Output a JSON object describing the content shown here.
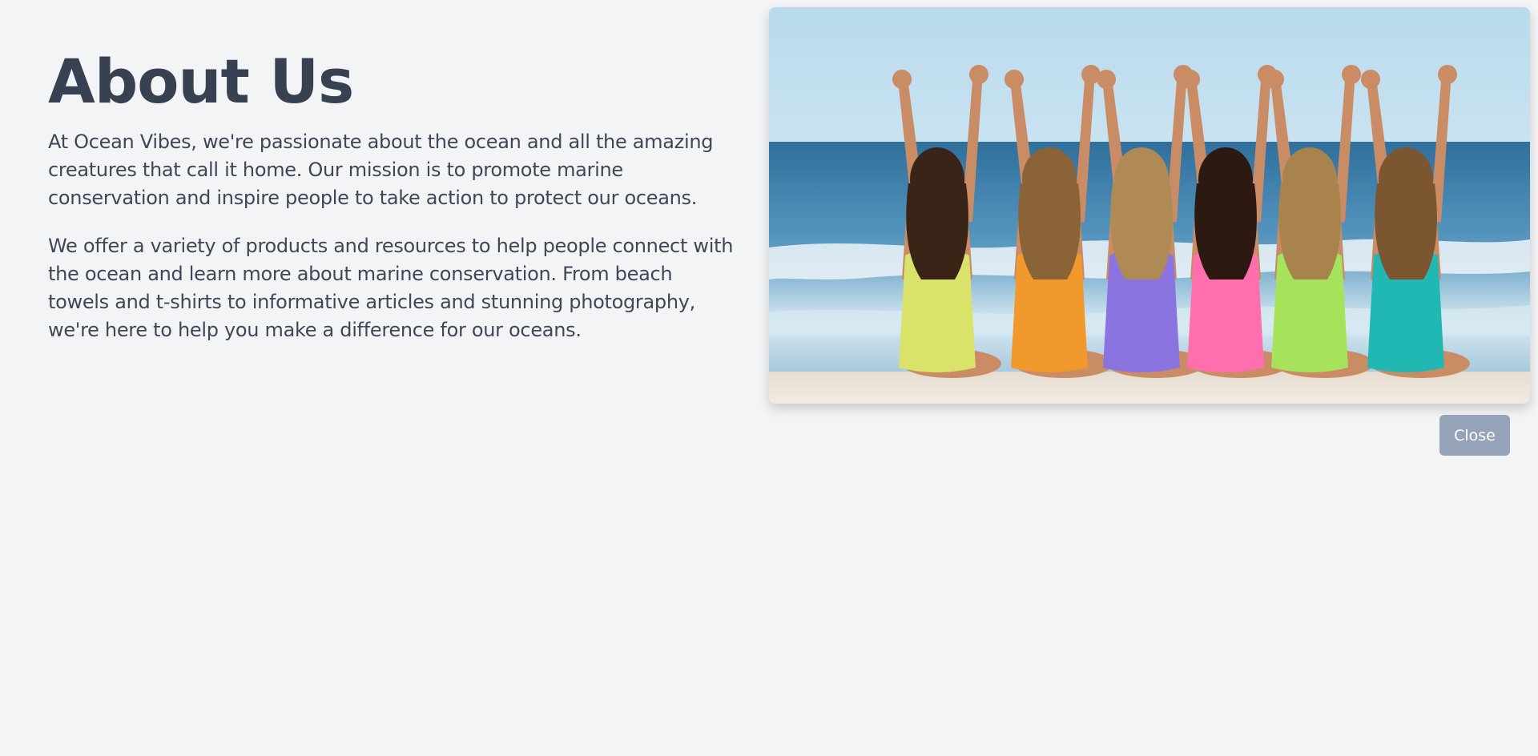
{
  "about": {
    "title": "About Us",
    "paragraphs": [
      "At Ocean Vibes, we're passionate about the ocean and all the amazing creatures that call it home. Our mission is to promote marine conservation and inspire people to take action to protect our oceans.",
      "We offer a variety of products and resources to help people connect with the ocean and learn more about marine conservation. From beach towels and t-shirts to informative articles and stunning photography, we're here to help you make a difference for our oceans."
    ]
  },
  "photo": {
    "swimsuit_colors": [
      "#d9e36a",
      "#f2992e",
      "#8b74e0",
      "#ff6fae",
      "#a6e35a",
      "#21b7b3"
    ],
    "sky_color": "#b8d9ec",
    "sea_color": "#4f8fb8",
    "sand_color": "#ece4d8"
  },
  "actions": {
    "close_label": "Close"
  }
}
